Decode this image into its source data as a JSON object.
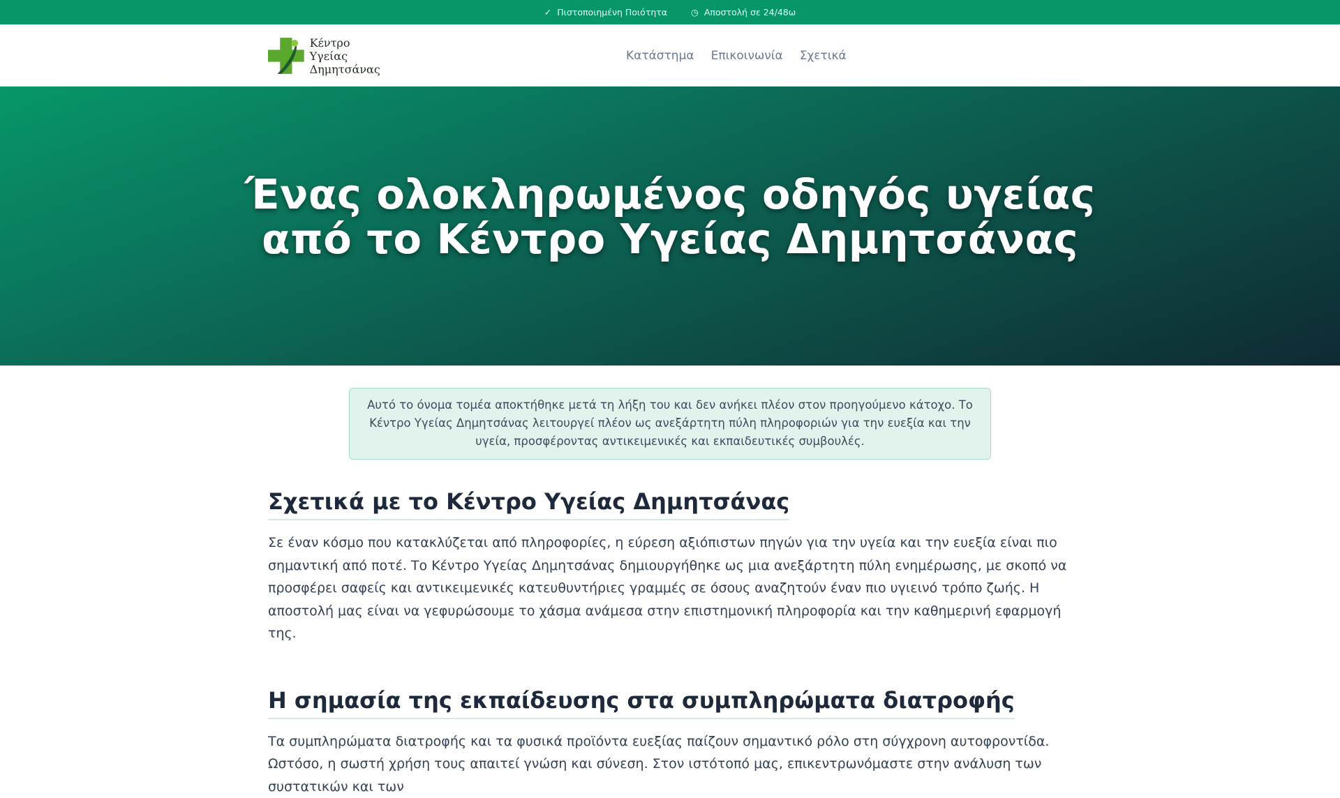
{
  "topbar": {
    "items": [
      {
        "icon": "check-icon",
        "label": "Πιστοποιημένη Ποιότητα"
      },
      {
        "icon": "clock-icon",
        "label": "Αποστολή σε 24/48ω"
      }
    ]
  },
  "header": {
    "logo": {
      "line1": "Κέντρο Υγείας",
      "line2": "Δημητσάνας"
    },
    "nav": [
      "Κατάστημα",
      "Επικοινωνία",
      "Σχετικά"
    ]
  },
  "hero": {
    "line1": "Ένας ολοκληρωμένος οδηγός υγείας",
    "line2": "από το Κέντρο Υγείας Δημητσάνας"
  },
  "notice": "Αυτό το όνομα τομέα αποκτήθηκε μετά τη λήξη του και δεν ανήκει πλέον στον προηγούμενο κάτοχο. Το Κέντρο Υγείας Δημητσάνας λειτουργεί πλέον ως ανεξάρτητη πύλη πληροφοριών για την ευεξία και την υγεία, προσφέροντας αντικειμενικές και εκπαιδευτικές συμβουλές.",
  "sections": [
    {
      "title": "Σχετικά με το Κέντρο Υγείας Δημητσάνας",
      "text": "Σε έναν κόσμο που κατακλύζεται από πληροφορίες, η εύρεση αξιόπιστων πηγών για την υγεία και την ευεξία είναι πιο σημαντική από ποτέ. Το Κέντρο Υγείας Δημητσάνας δημιουργήθηκε ως μια ανεξάρτητη πύλη ενημέρωσης, με σκοπό να προσφέρει σαφείς και αντικειμενικές κατευθυντήριες γραμμές σε όσους αναζητούν έναν πιο υγιεινό τρόπο ζωής. Η αποστολή μας είναι να γεφυρώσουμε το χάσμα ανάμεσα στην επιστημονική πληροφορία και την καθημερινή εφαρμογή της."
    },
    {
      "title": "Η σημασία της εκπαίδευσης στα συμπληρώματα διατροφής",
      "text": "Τα συμπληρώματα διατροφής και τα φυσικά προϊόντα ευεξίας παίζουν σημαντικό ρόλο στη σύγχρονη αυτοφροντίδα. Ωστόσο, η σωστή χρήση τους απαιτεί γνώση και σύνεση. Στον ιστότοπό μας, επικεντρωνόμαστε στην ανάλυση των συστατικών και των"
    }
  ]
}
